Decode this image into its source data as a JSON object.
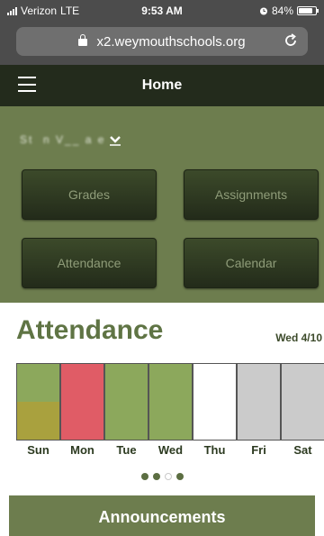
{
  "status_bar": {
    "carrier": "Verizon",
    "network": "LTE",
    "time": "9:53 AM",
    "battery": "84%",
    "battery_level": 0.84
  },
  "browser": {
    "url": "x2.weymouthschools.org"
  },
  "header": {
    "title": "Home"
  },
  "student": {
    "name": "St  n  V__  a  e"
  },
  "nav_buttons": {
    "grades": "Grades",
    "assignments": "Assignments",
    "attendance": "Attendance",
    "calendar": "Calendar"
  },
  "attendance": {
    "title": "Attendance",
    "date": "Wed 4/10",
    "days": [
      {
        "label": "Sun",
        "colors": [
          "#8ca85c",
          "#a9a13e"
        ]
      },
      {
        "label": "Mon",
        "colors": [
          "#e05c66"
        ]
      },
      {
        "label": "Tue",
        "colors": [
          "#8ca85c"
        ]
      },
      {
        "label": "Wed",
        "colors": [
          "#8ca85c"
        ]
      },
      {
        "label": "Thu",
        "colors": [
          "#ffffff"
        ]
      },
      {
        "label": "Fri",
        "colors": [
          "#cbcbcb"
        ]
      },
      {
        "label": "Sat",
        "colors": [
          "#cbcbcb"
        ]
      }
    ]
  },
  "pager": {
    "count": 4,
    "active": [
      true,
      true,
      false,
      true
    ]
  },
  "announcements": {
    "title": "Announcements"
  },
  "colors": {
    "brand_green": "#6d7d4e",
    "header_dark": "#232b1c",
    "title_green": "#5f7444"
  }
}
